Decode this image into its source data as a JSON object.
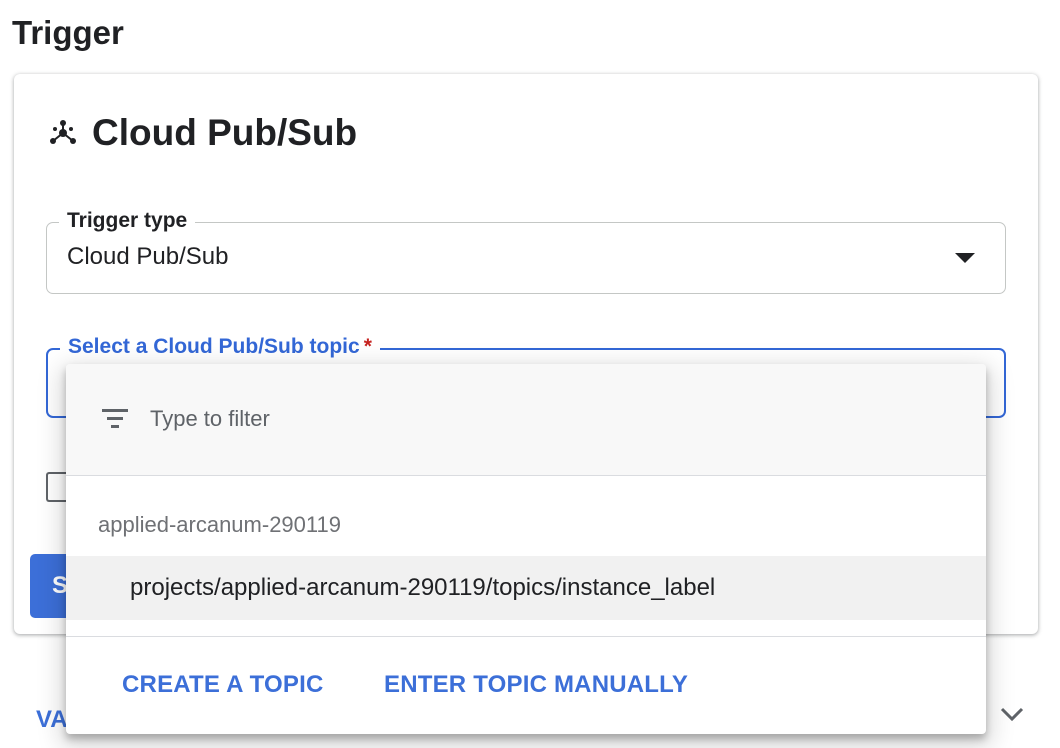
{
  "section": {
    "title": "Trigger"
  },
  "card": {
    "title": "Cloud Pub/Sub",
    "icon": "pubsub-icon"
  },
  "trigger_type": {
    "label": "Trigger type",
    "value": "Cloud Pub/Sub"
  },
  "topic_field": {
    "label": "Select a Cloud Pub/Sub topic",
    "required_marker": "*"
  },
  "save_button": {
    "label": "S"
  },
  "variables": {
    "label": "VA"
  },
  "dropdown": {
    "filter_placeholder": "Type to filter",
    "group_label": "applied-arcanum-290119",
    "options": [
      "projects/applied-arcanum-290119/topics/instance_label"
    ],
    "create_topic_label": "CREATE A TOPIC",
    "enter_manually_label": "ENTER TOPIC MANUALLY"
  },
  "colors": {
    "accent": "#3c6fd8",
    "focus_border": "#3367d6",
    "required": "#c5221f"
  }
}
